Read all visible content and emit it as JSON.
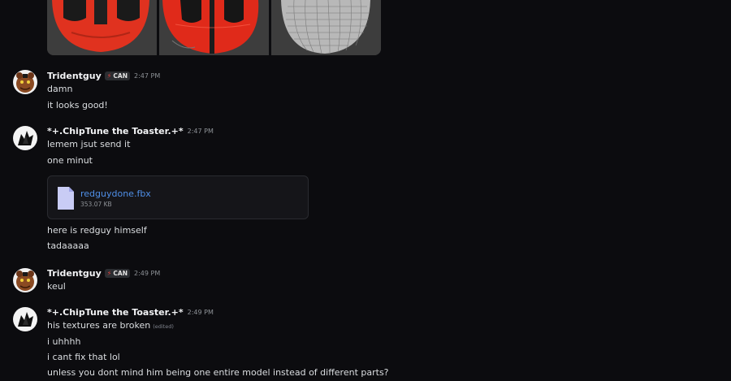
{
  "messages": [
    {
      "author": "Tridentguy",
      "tag": "CAN",
      "time": "2:47 PM",
      "lines": [
        "damn",
        "it looks good!"
      ]
    },
    {
      "author": "*+.ChipTune the Toaster.+*",
      "time": "2:47 PM",
      "lines": [
        "lemem jsut send it",
        "one minut"
      ],
      "attachment": {
        "name": "redguydone.fbx",
        "size": "353.07 KB"
      },
      "after_lines": [
        "here is redguy himself",
        "tadaaaaa"
      ]
    },
    {
      "author": "Tridentguy",
      "tag": "CAN",
      "time": "2:49 PM",
      "lines": [
        "keul"
      ]
    },
    {
      "author": "*+.ChipTune the Toaster.+*",
      "time": "2:49 PM",
      "lines": [
        "his textures are broken",
        "i uhhhh",
        "i cant fix that lol",
        "unless you dont mind him being one entire model instead of different parts?"
      ],
      "edited_label": "(edited)"
    }
  ],
  "colors": {
    "background": "#0c0c0f",
    "link": "#4f8fe8",
    "tag_bolt": "#e8413b",
    "model_red": "#e0321f"
  }
}
